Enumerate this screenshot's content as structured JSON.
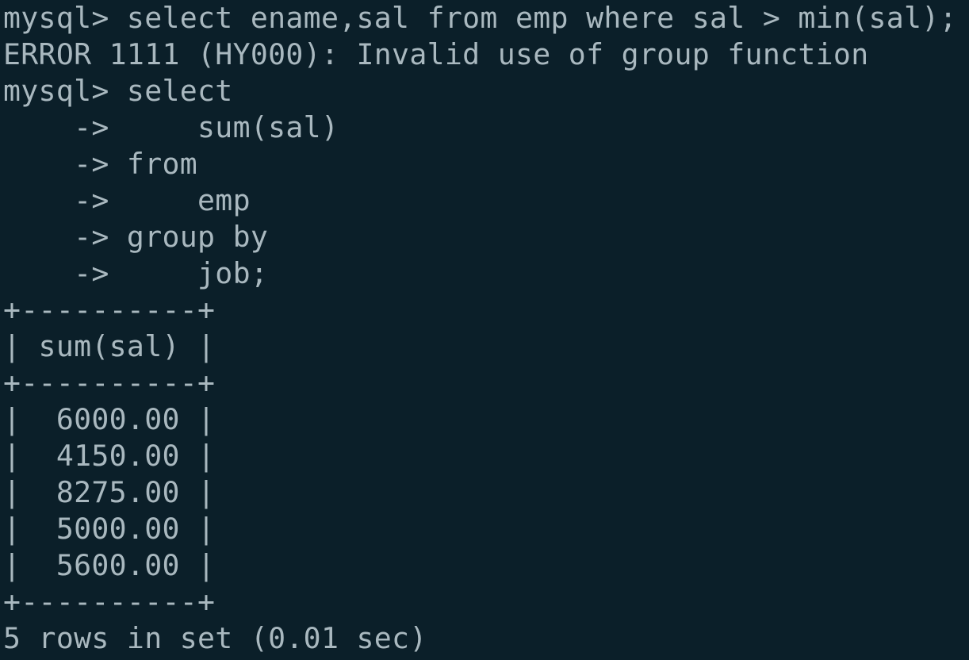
{
  "terminal": {
    "lines": [
      "mysql> select ename,sal from emp where sal > min(sal);",
      "ERROR 1111 (HY000): Invalid use of group function",
      "mysql> select",
      "    ->     sum(sal)",
      "    -> from",
      "    ->     emp",
      "    -> group by",
      "    ->     job;",
      "+----------+",
      "| sum(sal) |",
      "+----------+",
      "|  6000.00 |",
      "|  4150.00 |",
      "|  8275.00 |",
      "|  5000.00 |",
      "|  5600.00 |",
      "+----------+",
      "5 rows in set (0.01 sec)"
    ]
  }
}
